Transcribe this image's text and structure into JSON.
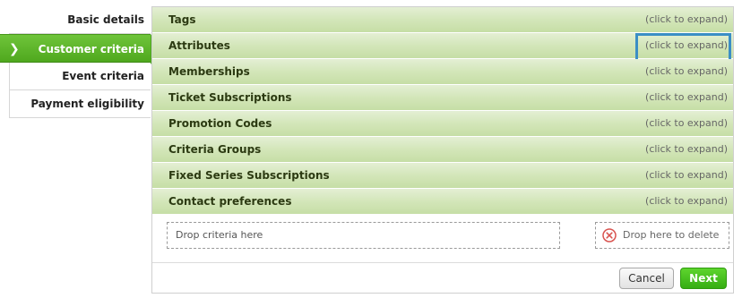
{
  "steps": [
    {
      "label": "Basic details"
    },
    {
      "label": "Customer criteria",
      "active": true,
      "chevron": "❯"
    },
    {
      "label": "Event criteria"
    },
    {
      "label": "Payment eligibility"
    }
  ],
  "accordion": [
    {
      "title": "Tags",
      "expand": "(click to expand)"
    },
    {
      "title": "Attributes",
      "expand": "(click to expand)"
    },
    {
      "title": "Memberships",
      "expand": "(click to expand)"
    },
    {
      "title": "Ticket Subscriptions",
      "expand": "(click to expand)"
    },
    {
      "title": "Promotion Codes",
      "expand": "(click to expand)"
    },
    {
      "title": "Criteria Groups",
      "expand": "(click to expand)"
    },
    {
      "title": "Fixed Series Subscriptions",
      "expand": "(click to expand)"
    },
    {
      "title": "Contact preferences",
      "expand": "(click to expand)"
    }
  ],
  "drop": {
    "criteria_placeholder": "Drop criteria here",
    "delete_label": "Drop here to delete"
  },
  "buttons": {
    "cancel": "Cancel",
    "next": "Next"
  },
  "colors": {
    "accent_green": "#4fa81e",
    "row_green": "#d3e6b9",
    "highlight_blue": "#3b8ec5",
    "delete_red": "#d9534f"
  },
  "icons": {
    "active_step": "chevron-right-icon",
    "delete": "close-circle-icon"
  }
}
